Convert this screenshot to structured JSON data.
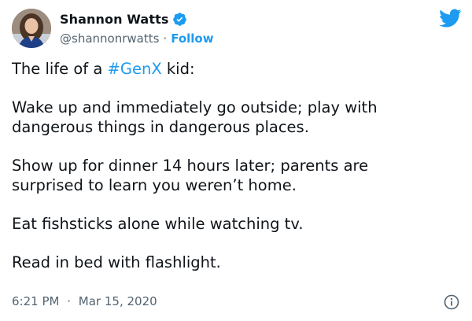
{
  "author": {
    "display_name": "Shannon Watts",
    "handle": "@shannonrwatts",
    "separator": "·",
    "follow_label": "Follow",
    "verified": true
  },
  "tweet": {
    "line1_prefix": "The life of a ",
    "hashtag": "#GenX",
    "line1_suffix": " kid:",
    "paragraph2": "Wake up and immediately go outside; play with\ndangerous things in dangerous places.",
    "paragraph3": "Show up for dinner 14 hours later; parents are\nsurprised to learn you weren’t home.",
    "paragraph4": "Eat fishsticks alone while watching tv.",
    "paragraph5": "Read in bed with flashlight."
  },
  "meta": {
    "time": "6:21 PM",
    "separator": "·",
    "date": "Mar 15, 2020"
  },
  "icons": {
    "brand": "twitter-bird-icon",
    "verified": "verified-badge-icon",
    "info": "info-icon"
  },
  "colors": {
    "accent": "#1d9bf0",
    "text": "#0f1419",
    "muted": "#536471"
  }
}
